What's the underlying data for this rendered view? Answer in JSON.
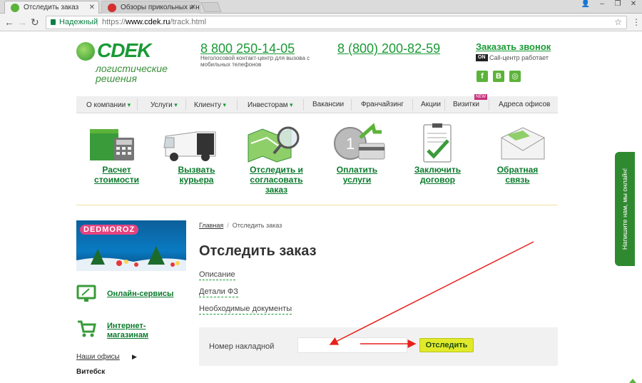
{
  "browser": {
    "tabs": [
      {
        "title": "Отследить заказ",
        "active": true,
        "favicon_color": "#5cb33a"
      },
      {
        "title": "Обзоры прикольных и нео",
        "active": false,
        "favicon_color": "#d32f2f"
      }
    ],
    "secure_label": "Надежный",
    "url_scheme": "https://",
    "url_host": "www.cdek.ru",
    "url_path": "/track.html"
  },
  "header": {
    "logo_text": "СDEK",
    "logo_subtitle": "логистические решения",
    "phone_main": "8 800 250-14-05",
    "phone_main_note": "Неголосовой контакт-центр для вызова с мобильных телефонов",
    "phone_alt": "8 (800) 200-82-59",
    "callback_label": "Заказать звонок",
    "on_badge": "ON",
    "call_status": "Call-центр работает",
    "social": [
      "f",
      "В",
      "◎"
    ]
  },
  "nav": {
    "items": [
      {
        "label": "О компании",
        "dropdown": true
      },
      {
        "label": "Услуги",
        "dropdown": true
      },
      {
        "label": "Клиенту",
        "dropdown": true
      },
      {
        "label": "Инвесторам",
        "dropdown": true
      },
      {
        "label": "Вакансии",
        "dropdown": false
      },
      {
        "label": "Франчайзинг",
        "dropdown": false
      },
      {
        "label": "Акции",
        "dropdown": false
      },
      {
        "label": "Визитки",
        "dropdown": false
      },
      {
        "label": "Адреса офисов",
        "dropdown": false
      }
    ],
    "new_badge": "NEW"
  },
  "services": [
    {
      "label": "Расчет\nстоимости",
      "icon": "calculator-box-icon"
    },
    {
      "label": "Вызвать\nкурьера",
      "icon": "courier-van-icon"
    },
    {
      "label": "Отследить и\nсогласовать\nзаказ",
      "icon": "map-magnifier-icon"
    },
    {
      "label": "Оплатить\nуслуги",
      "icon": "coin-card-icon"
    },
    {
      "label": "Заключить\nдоговор",
      "icon": "contract-clipboard-icon"
    },
    {
      "label": "Обратная\nсвязь",
      "icon": "feedback-envelope-icon"
    }
  ],
  "sidebar": {
    "banner_text": "DEDMOROZ",
    "online_services": "Онлайн-сервисы",
    "internet_shops": "Интернет-\nмагазинам",
    "offices": "Наши офисы",
    "city": "Витебск"
  },
  "main": {
    "breadcrumb_home": "Главная",
    "breadcrumb_current": "Отследить заказ",
    "title": "Отследить заказ",
    "links": [
      "Описание",
      "Детали ФЗ",
      "Необходимые документы"
    ],
    "track_label": "Номер накладной",
    "track_value": "",
    "track_button": "Отследить"
  },
  "side_tab": "Напишите нам, мы онлайн!",
  "colors": {
    "brand": "#1a9a35",
    "button": "#e1ea2a",
    "annotation": "#e8201a"
  }
}
